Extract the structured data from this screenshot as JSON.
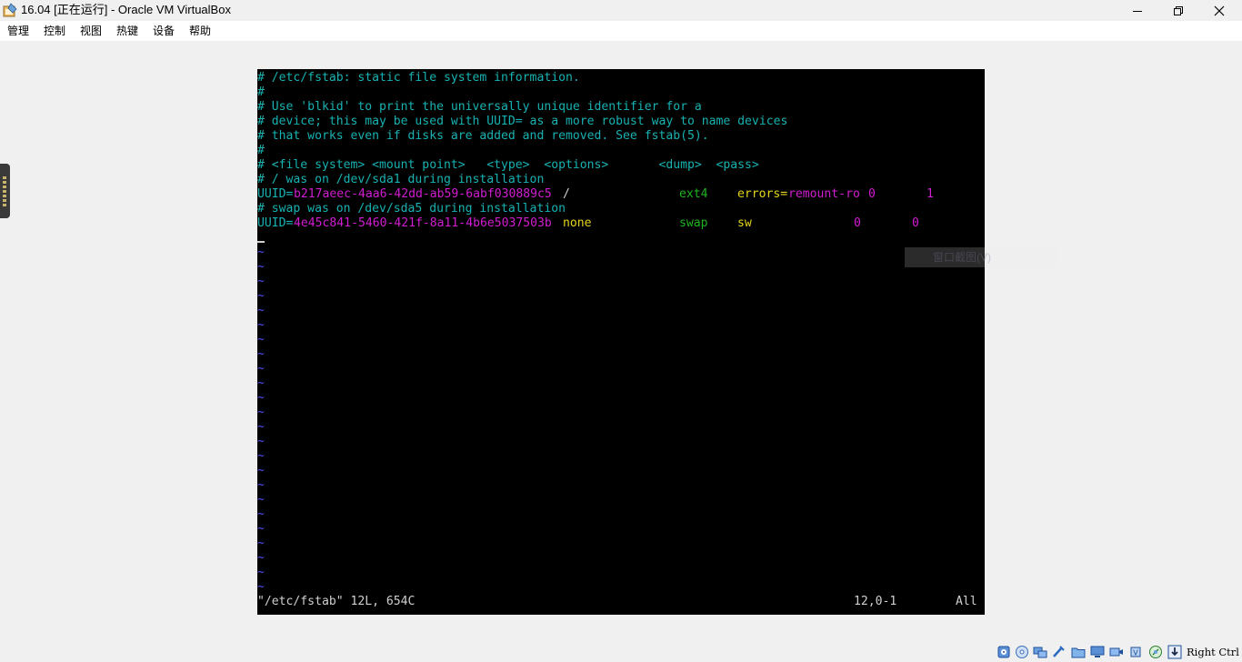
{
  "window": {
    "title": "16.04 [正在运行] - Oracle VM VirtualBox",
    "app_icon": "virtualbox-icon",
    "controls": {
      "minimize": "minimize-icon",
      "maximize": "restore-icon",
      "close": "close-icon"
    }
  },
  "menu": {
    "items": [
      "管理",
      "控制",
      "视图",
      "热键",
      "设备",
      "帮助"
    ]
  },
  "terminal": {
    "comments": [
      "# /etc/fstab: static file system information.",
      "#",
      "# Use 'blkid' to print the universally unique identifier for a",
      "# device; this may be used with UUID= as a more robust way to name devices",
      "# that works even if disks are added and removed. See fstab(5).",
      "#",
      "# <file system> <mount point>   <type>  <options>       <dump>  <pass>",
      "# / was on /dev/sda1 during installation"
    ],
    "entry1": {
      "key": "UUID=",
      "uuid": "b217aeec-4aa6-42dd-ab59-6abf030889c5",
      "mount": "/",
      "type": "ext4",
      "opt_key": "errors=",
      "opt_val": "remount-ro",
      "dump": "0",
      "pass": "1"
    },
    "swap_comment": "# swap was on /dev/sda5 during installation",
    "entry2": {
      "key": "UUID=",
      "uuid": "4e45c841-5460-421f-8a11-4b6e5037503b",
      "mount": "none",
      "type": "swap",
      "opt": "sw",
      "dump": "0",
      "pass": "0"
    },
    "tilde": "~",
    "status_file": "\"/etc/fstab\" 12L, 654C",
    "status_pos": "12,0-1",
    "status_scroll": "All"
  },
  "context_ghost": "窗口截图(V)",
  "statusbar": {
    "icons": [
      "hard-disk-icon",
      "optical-drive-icon",
      "network-icon",
      "usb-icon",
      "shared-folder-icon",
      "display-icon",
      "video-capture-icon",
      "cpu-icon",
      "mouse-integration-icon",
      "keyboard-icon"
    ],
    "host_key": "Right Ctrl"
  },
  "colors": {
    "comment": "#18b2b2",
    "constant": "#d11dd1",
    "type": "#1fb41f",
    "special": "#e6d61a",
    "tilde": "#4d4dff"
  }
}
